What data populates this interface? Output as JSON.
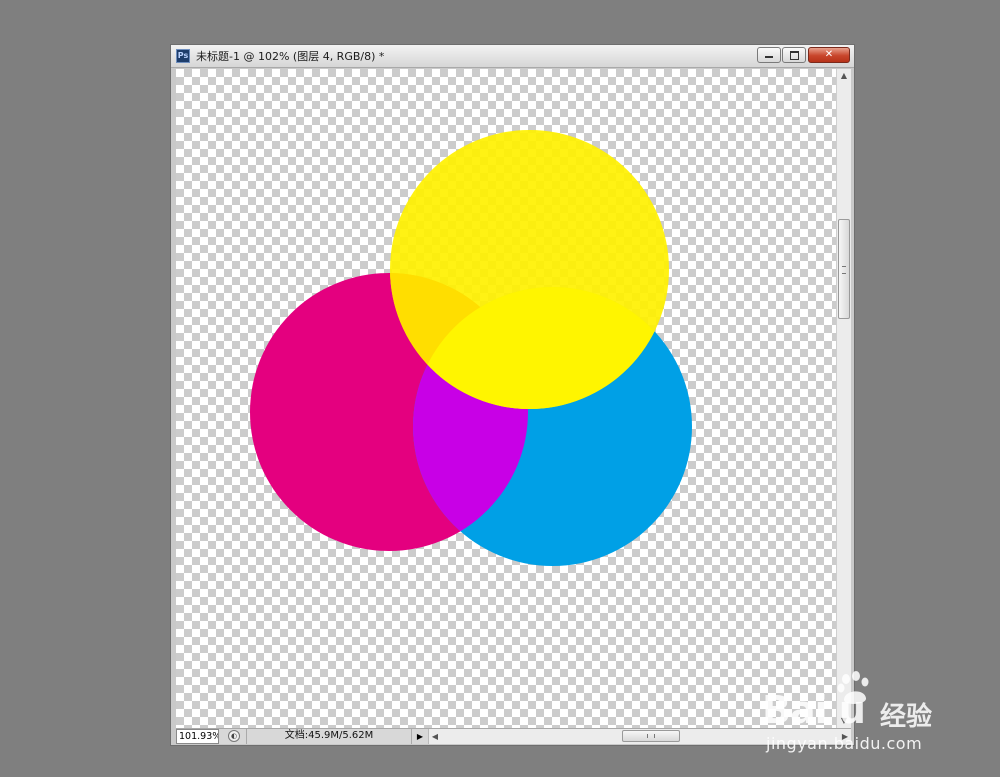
{
  "window": {
    "app_icon": "Ps",
    "title": "未标题-1 @ 102% (图层 4, RGB/8) *",
    "controls": {
      "minimize_icon": "minimize-icon",
      "maximize_icon": "maximize-icon",
      "close_label": "✕"
    }
  },
  "canvas": {
    "background": "transparency-checkerboard",
    "shapes": [
      {
        "name": "magenta-circle",
        "color": "#e4007f"
      },
      {
        "name": "cyan-circle",
        "color": "#00a0e6"
      },
      {
        "name": "yellow-circle",
        "color": "#fff100"
      }
    ],
    "overlap_colors": {
      "magenta_cyan": "#c800e6",
      "magenta_yellow": "#ffde00"
    }
  },
  "statusbar": {
    "zoom": "101.93%",
    "doc_info": "文档:45.9M/5.62M",
    "menu_arrow": "▶",
    "hscroll_left": "◀",
    "hscroll_right": "▶"
  },
  "vscroll": {
    "up": "▲",
    "down": "▼"
  },
  "watermark": {
    "logo": "Bai  u",
    "brand_cn": "经验",
    "url": "jingyan.baidu.com"
  }
}
